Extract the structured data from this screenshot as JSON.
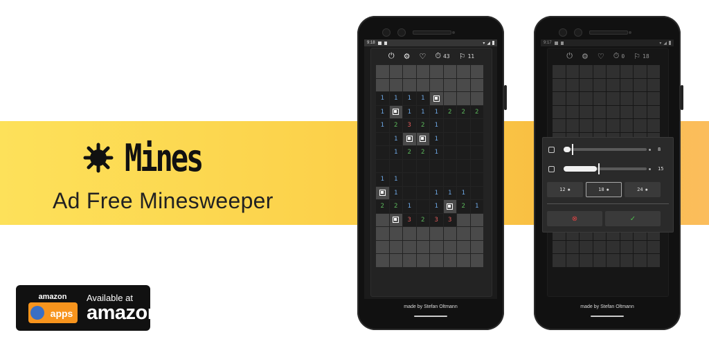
{
  "title": "Mines",
  "subtitle": "Ad Free Minesweeper",
  "badge": {
    "logo_top": "amazon",
    "logo_bottom": "apps",
    "available": "Available at",
    "brand": "amazon"
  },
  "colors": {
    "band": "#fcd24b",
    "screen_bg": "#1b1b1b",
    "hidden_cell": "#4a4a4a",
    "num1": "#6ea8e6",
    "num2": "#5dbb5d",
    "num3": "#e05a5a"
  },
  "phone1": {
    "time": "9:18",
    "timer": "43",
    "flags": "11",
    "credit": "made by Stefan Oltmann",
    "grid": [
      [
        "h",
        "h",
        "h",
        "h",
        "h",
        "h",
        "h",
        "h"
      ],
      [
        "h",
        "h",
        "h",
        "h",
        "h",
        "h",
        "h",
        "h"
      ],
      [
        "1",
        "1",
        "1",
        "1",
        "F",
        "h",
        "h",
        "h"
      ],
      [
        "1",
        "F",
        "1",
        "1",
        "1",
        "2",
        "2",
        "2"
      ],
      [
        "1",
        "2",
        "3",
        "2",
        "1",
        "o",
        "o",
        "o"
      ],
      [
        "o",
        "1",
        "F",
        "F",
        "1",
        "o",
        "o",
        "o"
      ],
      [
        "o",
        "1",
        "2",
        "2",
        "1",
        "o",
        "o",
        "o"
      ],
      [
        "o",
        "o",
        "o",
        "o",
        "o",
        "o",
        "o",
        "o"
      ],
      [
        "1",
        "1",
        "o",
        "o",
        "o",
        "o",
        "o",
        "o"
      ],
      [
        "F",
        "1",
        "o",
        "o",
        "1",
        "1",
        "1",
        "o"
      ],
      [
        "2",
        "2",
        "1",
        "o",
        "1",
        "F",
        "2",
        "1"
      ],
      [
        "h",
        "F",
        "3",
        "2",
        "3",
        "3",
        "h",
        "h"
      ],
      [
        "h",
        "h",
        "h",
        "h",
        "h",
        "h",
        "h",
        "h"
      ],
      [
        "h",
        "h",
        "h",
        "h",
        "h",
        "h",
        "h",
        "h"
      ],
      [
        "h",
        "h",
        "h",
        "h",
        "h",
        "h",
        "h",
        "h"
      ]
    ]
  },
  "phone2": {
    "time": "9:17",
    "timer": "0",
    "flags": "18",
    "credit": "made by Stefan Oltmann",
    "dialog": {
      "width_value": "8",
      "height_value": "15",
      "width_level": 0.08,
      "height_level": 0.4,
      "presets": [
        {
          "label": "12",
          "selected": false
        },
        {
          "label": "18",
          "selected": true
        },
        {
          "label": "24",
          "selected": false
        }
      ],
      "cancel_icon": "cancel-circle-icon",
      "confirm_icon": "check-icon"
    }
  }
}
